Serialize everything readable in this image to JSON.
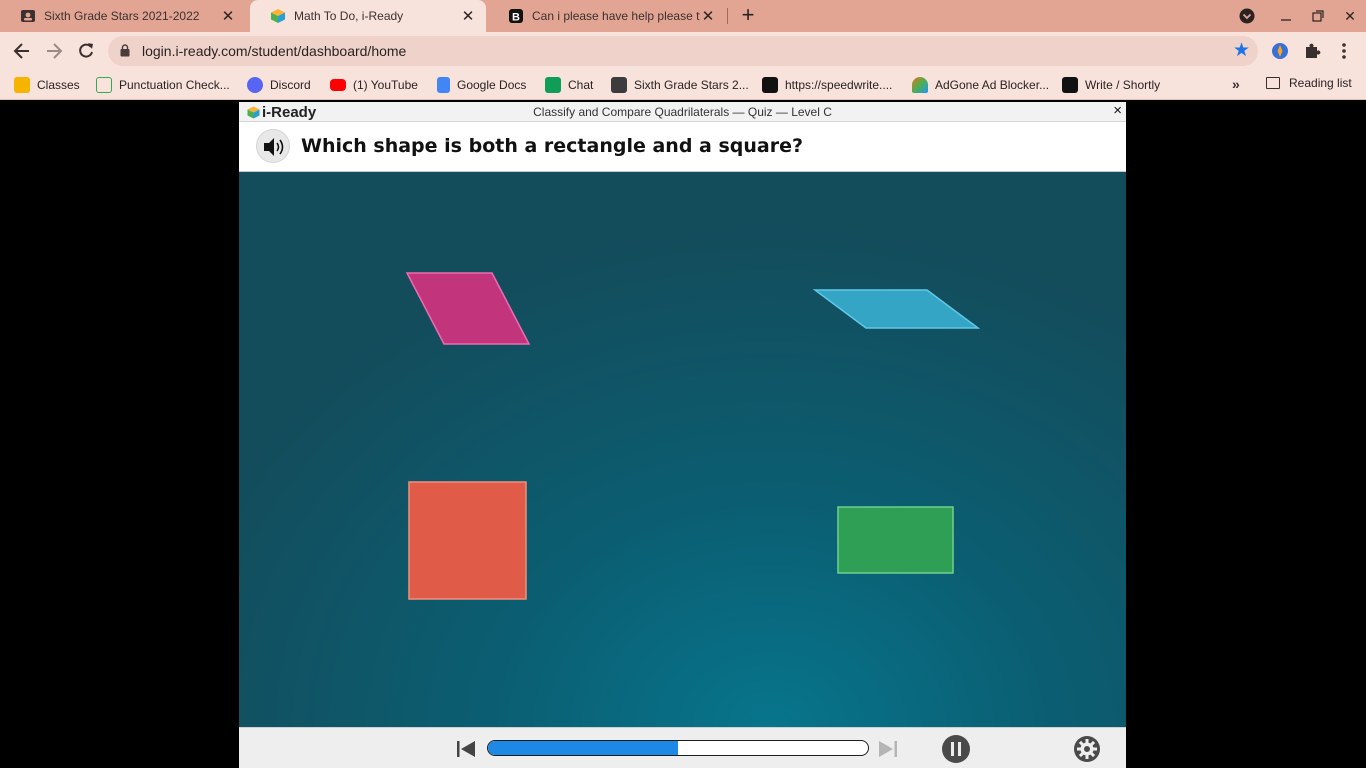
{
  "browser": {
    "tabs": [
      {
        "title": "Sixth Grade Stars 2021-2022",
        "active": false,
        "icon": "classroom-icon"
      },
      {
        "title": "Math To Do, i-Ready",
        "active": true,
        "icon": "iready-cube-icon"
      },
      {
        "title": "Can i please have help please ty",
        "active": false,
        "icon": "brainly-icon"
      }
    ],
    "new_tab_label": "+",
    "url": "login.i-ready.com/student/dashboard/home"
  },
  "bookmarks": [
    {
      "label": "Classes",
      "color": "#f4b400"
    },
    {
      "label": "Punctuation Check...",
      "color": "#34a853"
    },
    {
      "label": "Discord",
      "color": "#5865f2"
    },
    {
      "label": "(1) YouTube",
      "color": "#ff0000"
    },
    {
      "label": "Google Docs",
      "color": "#4285f4"
    },
    {
      "label": "Chat",
      "color": "#0f9d58"
    },
    {
      "label": "Sixth Grade Stars 2...",
      "color": "#3c3c3c"
    },
    {
      "label": "https://speedwrite....",
      "color": "#111111"
    },
    {
      "label": "AdGone Ad Blocker...",
      "color": "#e8711c"
    },
    {
      "label": "Write / Shortly",
      "color": "#111111"
    }
  ],
  "bookmarks_overflow": "»",
  "reading_list": "Reading list",
  "lesson": {
    "logo_text": "i-Ready",
    "title": "Classify and Compare Quadrilaterals — Quiz — Level C",
    "close": "×",
    "question": "Which shape is both a rectangle and a square?",
    "shapes": [
      {
        "name": "pink-parallelogram",
        "color": "#c2357d"
      },
      {
        "name": "blue-parallelogram",
        "color": "#35a5c6"
      },
      {
        "name": "orange-square",
        "color": "#e05b48"
      },
      {
        "name": "green-rectangle",
        "color": "#2e9f54"
      }
    ],
    "progress": 0.5
  }
}
